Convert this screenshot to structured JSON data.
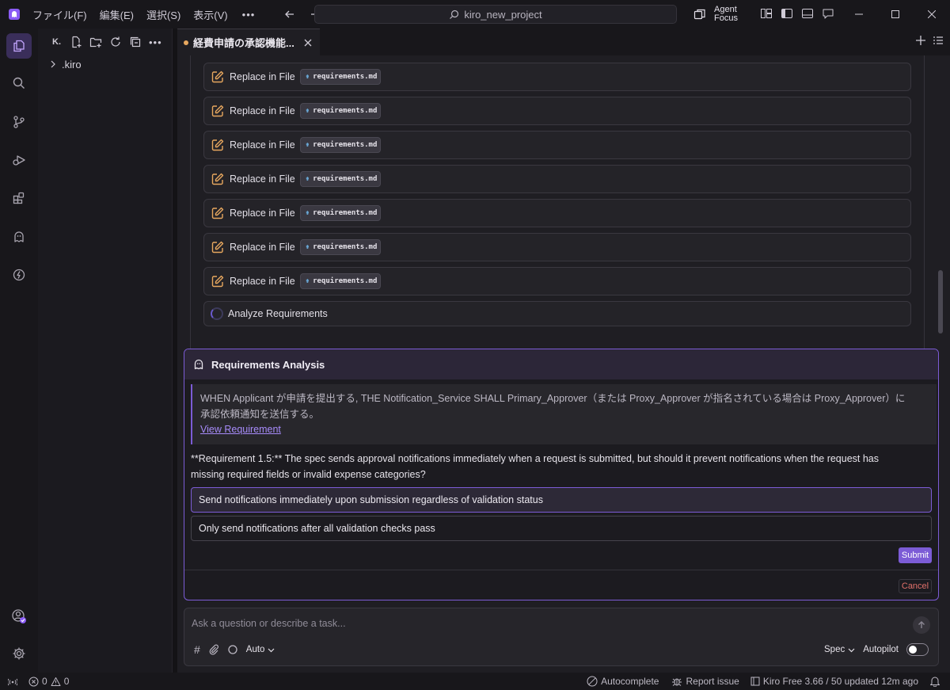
{
  "titlebar": {
    "menus": [
      "ファイル(F)",
      "編集(E)",
      "選択(S)",
      "表示(V)"
    ],
    "more": "•••",
    "search": "kiro_new_project",
    "agent_focus": [
      "Agent",
      "Focus"
    ]
  },
  "sidebar": {
    "title": "K.",
    "tree": [
      ".kiro"
    ]
  },
  "tab": {
    "label": "経費申請の承認機能..."
  },
  "operations": {
    "label": "Replace in File",
    "file": "requirements.md",
    "analyze": "Analyze Requirements"
  },
  "analysis": {
    "title": "Requirements Analysis",
    "quote_line1": "WHEN Applicant が申請を提出する, THE Notification_Service SHALL Primary_Approver（または Proxy_Approver が指名されている場合は Proxy_Approver）に",
    "quote_line2": "承認依頼通知を送信する。",
    "view_link": "View Requirement",
    "question_line1": "**Requirement 1.5:** The spec sends approval notifications immediately when a request is submitted, but should it prevent notifications when the request has",
    "question_line2": "missing required fields or invalid expense categories?",
    "options": [
      "Send notifications immediately upon submission regardless of validation status",
      "Only send notifications after all validation checks pass"
    ],
    "submit": "Submit",
    "cancel": "Cancel"
  },
  "chat": {
    "placeholder": "Ask a question or describe a task...",
    "model": "Auto",
    "mode": "Spec",
    "autopilot": "Autopilot",
    "autopilot_on": false
  },
  "status": {
    "errors": "0",
    "warnings": "0",
    "autocomplete": "Autocomplete",
    "report": "Report issue",
    "plan": "Kiro Free 3.66 / 50 updated 12m ago"
  }
}
